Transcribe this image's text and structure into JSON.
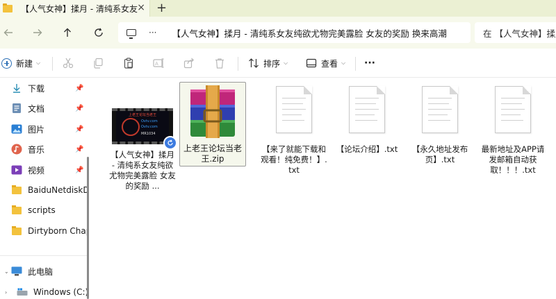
{
  "window": {
    "tab_title": "【人气女神】揉月 - 清纯系女友纯欲尤物完美露脸 女友的奖励 换来高潮",
    "tab_close": "×",
    "new_tab": "+"
  },
  "address_bar": {
    "path": "【人气女神】揉月 - 清纯系女友纯欲尤物完美露脸 女友的奖励 换来高潮",
    "overflow_label": "···",
    "search_placeholder": "在 【人气女神】揉月 - 清纯系女友"
  },
  "toolbar": {
    "new_label": "新建",
    "sort_label": "排序",
    "view_label": "查看",
    "more_label": "···"
  },
  "sidebar": {
    "quick_access": [
      {
        "label": "下载",
        "icon": "download-icon",
        "pinned": true
      },
      {
        "label": "文档",
        "icon": "documents-icon",
        "pinned": true
      },
      {
        "label": "图片",
        "icon": "pictures-icon",
        "pinned": true
      },
      {
        "label": "音乐",
        "icon": "music-icon",
        "pinned": true
      },
      {
        "label": "视频",
        "icon": "videos-icon",
        "pinned": true
      }
    ],
    "folders": [
      {
        "label": "BaiduNetdiskDownload"
      },
      {
        "label": "scripts"
      },
      {
        "label": "Dirtyborn Chapter"
      }
    ],
    "this_pc_label": "此电脑",
    "drive_label": "Windows (C:)"
  },
  "files": [
    {
      "name": "【人气女神】揉月 - 清纯系女友纯欲尤物完美露脸 女友的奖励 ...",
      "type": "video"
    },
    {
      "name": "上老王论坛当老王.zip",
      "type": "zip",
      "selected": true
    },
    {
      "name": "【来了就能下载和观看！纯免费！】.txt",
      "type": "txt"
    },
    {
      "name": "【论坛介绍】.txt",
      "type": "txt"
    },
    {
      "name": "【永久地址发布页】.txt",
      "type": "txt"
    },
    {
      "name": "最新地址及APP请发邮箱自动获取！！！.txt",
      "type": "txt"
    }
  ],
  "thumbnail": {
    "line1": "上老王论坛当老王",
    "line2": "Ovtv.com",
    "line3": "Ovtv.com",
    "line4": "MR1034"
  },
  "colors": {
    "titlebar": "#ebf0d3",
    "address_bg": "#f7f9ec",
    "folder": "#f3c23d",
    "accent": "#2b6fb5"
  }
}
